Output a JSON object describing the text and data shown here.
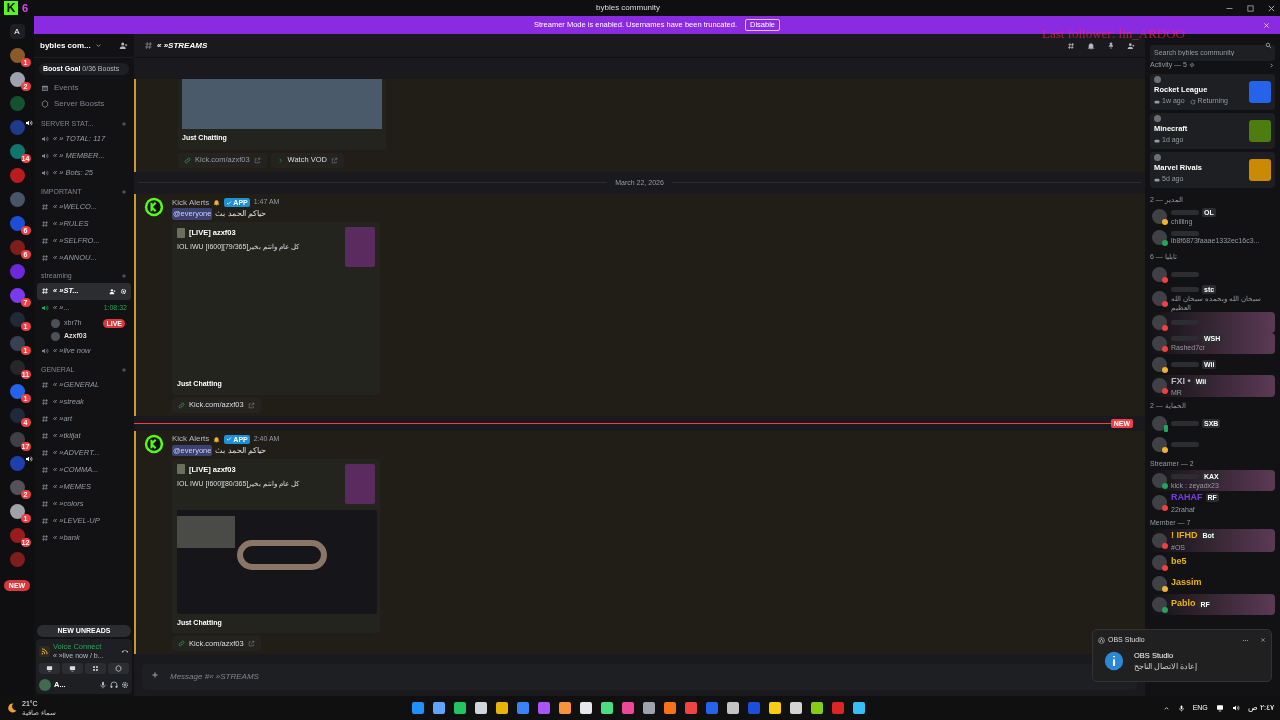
{
  "title_bar": {
    "logo": "K",
    "count": "6",
    "title": "bybles community",
    "overlay": "Last follower: lin_ARDOO"
  },
  "banner": {
    "text": "Streamer Mode is enabled. Usernames have been truncated.",
    "button": "Disable"
  },
  "server_rail": [
    {
      "kind": "letter",
      "label": "A",
      "audio": false
    },
    {
      "kind": "server",
      "color": "#8a5a2b",
      "badge": "1",
      "audio": false
    },
    {
      "kind": "server",
      "color": "#9ca3af",
      "badge": "2",
      "audio": false
    },
    {
      "kind": "server",
      "color": "#14532d",
      "audio": false
    },
    {
      "kind": "server",
      "color": "#1e3a8a",
      "audio": true
    },
    {
      "kind": "server",
      "color": "#0f766e",
      "badge": "14",
      "audio": false
    },
    {
      "kind": "server",
      "color": "#b91c1c",
      "audio": false
    },
    {
      "kind": "server",
      "color": "#475569",
      "audio": false
    },
    {
      "kind": "server",
      "color": "#1d4ed8",
      "badge": "6",
      "audio": false
    },
    {
      "kind": "server",
      "color": "#7f1d1d",
      "badge": "6",
      "audio": false
    },
    {
      "kind": "server",
      "color": "#6d28d9",
      "audio": false
    },
    {
      "kind": "server",
      "color": "#7c3aed",
      "badge": "7",
      "audio": false
    },
    {
      "kind": "server",
      "color": "#1f2937",
      "badge": "1",
      "audio": false
    },
    {
      "kind": "server",
      "color": "#374151",
      "badge": "1",
      "audio": false
    },
    {
      "kind": "server",
      "color": "#27272a",
      "badge": "11",
      "audio": false
    },
    {
      "kind": "server",
      "color": "#2563eb",
      "badge": "1",
      "audio": false
    },
    {
      "kind": "server",
      "color": "#1e293b",
      "badge": "4",
      "audio": false
    },
    {
      "kind": "server",
      "color": "#3f3f46",
      "badge": "17",
      "audio": false
    },
    {
      "kind": "server",
      "color": "#1e40af",
      "audio": true
    },
    {
      "kind": "server",
      "color": "#52525b",
      "badge": "2",
      "audio": false
    },
    {
      "kind": "server",
      "color": "#a1a1aa",
      "badge": "1",
      "audio": false
    },
    {
      "kind": "server",
      "color": "#991b1b",
      "badge": "12",
      "audio": false
    },
    {
      "kind": "server",
      "color": "#7f1d1d",
      "audio": false
    }
  ],
  "sidebar": {
    "server_name": "bybles com...",
    "boost": {
      "label": "Boost Goal",
      "value": "0/36 Boosts"
    },
    "links": [
      "Events",
      "Server Boosts"
    ],
    "categories": [
      {
        "name": "SERVER STAT...",
        "channels": [
          {
            "kind": "voice",
            "name": "« » TOTAL: 117",
            "selected": false
          },
          {
            "kind": "voice",
            "name": "« » MEMBER...",
            "selected": false
          },
          {
            "kind": "voice",
            "name": "« » Bots: 25",
            "selected": false
          }
        ]
      },
      {
        "name": "IMPORTANT",
        "channels": [
          {
            "kind": "text",
            "name": "« »WELCO...",
            "selected": false
          },
          {
            "kind": "text",
            "name": "« »RULES",
            "selected": false
          },
          {
            "kind": "text",
            "name": "« »SELFRO...",
            "selected": false
          },
          {
            "kind": "text",
            "name": "« »ANNOU...",
            "selected": false
          }
        ]
      },
      {
        "name": "streaming",
        "channels": [
          {
            "kind": "text",
            "name": "« »ST...",
            "selected": true
          },
          {
            "kind": "voice",
            "name": "« »...",
            "selected": false,
            "duration": "1:08:32",
            "users": [
              {
                "name": "xbr7h",
                "badge": "LIVE"
              },
              {
                "name": "Azxf03"
              }
            ]
          },
          {
            "kind": "voice",
            "name": "« »live now",
            "selected": false
          }
        ]
      },
      {
        "name": "GENERAL",
        "channels": [
          {
            "kind": "text",
            "name": "« »GENERAL",
            "selected": false
          },
          {
            "kind": "text",
            "name": "« »streak",
            "selected": false
          },
          {
            "kind": "text",
            "name": "« »art",
            "selected": false
          },
          {
            "kind": "text",
            "name": "« »tklijat",
            "selected": false
          },
          {
            "kind": "text",
            "name": "« »ADVERT...",
            "selected": false
          },
          {
            "kind": "text",
            "name": "« »COMMA...",
            "selected": false
          },
          {
            "kind": "text",
            "name": "« »MEMES",
            "selected": false
          },
          {
            "kind": "text",
            "name": "« »colors",
            "selected": false
          },
          {
            "kind": "text",
            "name": "« »LEVEL-UP",
            "selected": false
          },
          {
            "kind": "text",
            "name": "« »bank",
            "selected": false
          }
        ]
      }
    ],
    "new_pill": "NEW",
    "new_unreads": "NEW UNREADS",
    "voice_panel": {
      "status": "Voice Connect",
      "channel": "« »live now / b..."
    },
    "user_panel": {
      "name": "A..."
    },
    "weather": {
      "temp": "21°C",
      "text": "سماء صافية"
    }
  },
  "channel_header": {
    "name": "« »STREAMS",
    "search_placeholder": "Search bybles community"
  },
  "messages": [
    {
      "kind": "embed_tail",
      "category": "Just Chatting",
      "links": [
        {
          "kind": "link",
          "label": "Kick.com/azxf03"
        },
        {
          "kind": "vod",
          "label": "Watch VOD"
        }
      ]
    },
    {
      "kind": "divider",
      "label": "March 22, 2026"
    },
    {
      "kind": "message",
      "author": "Kick Alerts",
      "badge": "APP",
      "time": "1:47 AM",
      "mention": "@everyone",
      "text": "حياكم الحمد بث",
      "embed": {
        "kind": "no_image",
        "author": "[LIVE] azxf03",
        "title": "IOL IWU [I600][79/365]كل عام وانتم بخير",
        "category": "Just Chatting"
      },
      "links": [
        {
          "kind": "link",
          "label": "Kick.com/azxf03"
        }
      ]
    },
    {
      "kind": "new_divider",
      "label": "NEW"
    },
    {
      "kind": "message",
      "author": "Kick Alerts",
      "badge": "APP",
      "time": "2:40 AM",
      "mention": "@everyone",
      "text": "حياكم الحمد بث",
      "embed": {
        "kind": "image",
        "author": "[LIVE] azxf03",
        "title": "IOL IWU [I600][80/365]كل عام وانتم بخير",
        "category": "Just Chatting"
      },
      "links": [
        {
          "kind": "link",
          "label": "Kick.com/azxf03"
        }
      ]
    }
  ],
  "composer": {
    "placeholder": "Message #« »STREAMS"
  },
  "activity": {
    "title": "Activity — 5",
    "cards": [
      {
        "game": "Rocket League",
        "time": "1w ago",
        "status": "Returning",
        "color": "#2563eb"
      },
      {
        "game": "Minecraft",
        "time": "1d ago",
        "color": "#4d7c0f"
      },
      {
        "game": "Marvel Rivals",
        "time": "5d ago",
        "color": "#ca8a04"
      }
    ]
  },
  "member_groups": [
    {
      "title": "المدير — 2",
      "members": [
        {
          "tag": "OL",
          "sub": "chilling",
          "status": {
            "kind": "dot",
            "color": "#f0b232"
          },
          "banner": false
        },
        {
          "sub": "lb8f6873faaae1332ec16c3...",
          "status": {
            "kind": "dot",
            "color": "#23a55a"
          },
          "banner": false
        }
      ]
    },
    {
      "title": "تابليا — 6",
      "members": [
        {
          "status": {
            "kind": "dot",
            "color": "#f23f43"
          },
          "banner": false
        },
        {
          "tag": "stc",
          "sub": "سبحان الله وبحمده سبحان الله العظيم",
          "status": {
            "kind": "dot",
            "color": "#f23f43"
          },
          "banner": false
        },
        {
          "status": {
            "kind": "dot",
            "color": "#f23f43"
          },
          "banner": true
        },
        {
          "tag": "WSH",
          "sub": "Rashed7cr",
          "status": {
            "kind": "dot",
            "color": "#f23f43"
          },
          "banner": true
        },
        {
          "tag": "Wii",
          "status": {
            "kind": "dot",
            "color": "#f0b232"
          },
          "banner": false
        },
        {
          "name": "FXI •",
          "tag": "Wii",
          "sub": "MR",
          "status": {
            "kind": "dot",
            "color": "#f23f43"
          },
          "banner": true
        }
      ]
    },
    {
      "title": "الحماية — 2",
      "members": [
        {
          "tag": "SXB",
          "status": {
            "kind": "mobile",
            "color": "#23a55a"
          },
          "banner": false
        },
        {
          "status": {
            "kind": "dot",
            "color": "#f0b232"
          },
          "banner": false
        }
      ]
    },
    {
      "title": "Streamer — 2",
      "members": [
        {
          "tag": "KAX",
          "sub": "kick : zeyadx23",
          "status": {
            "kind": "dot",
            "color": "#23a55a"
          },
          "banner": true
        },
        {
          "name": "RAHAF",
          "color": "#7c3aed",
          "tag": "RF",
          "sub": "22rahaf",
          "status": {
            "kind": "dot",
            "color": "#f23f43"
          },
          "banner": false
        }
      ]
    },
    {
      "title": "Member — 7",
      "members": [
        {
          "name": "! IFHD",
          "color": "#eab308",
          "tag": "Bot",
          "sub": "#OS",
          "status": {
            "kind": "dot",
            "color": "#f23f43"
          },
          "banner": true
        },
        {
          "name": "be5",
          "color": "#eab308",
          "status": {
            "kind": "dot",
            "color": "#f23f43"
          },
          "banner": false
        },
        {
          "name": "Jassim",
          "color": "#eab308",
          "status": {
            "kind": "dot",
            "color": "#f0b232"
          },
          "banner": false
        },
        {
          "name": "Pablo",
          "color": "#eab308",
          "tag": "RF",
          "status": {
            "kind": "dot",
            "color": "#23a55a"
          },
          "banner": true
        }
      ]
    }
  ],
  "toast": {
    "app": "OBS Studio",
    "title": "OBS Studio",
    "text": "إعادة الاتصال الناجح"
  },
  "taskbar": {
    "lang": "ENG",
    "time": "٢:٤٧ ص"
  }
}
